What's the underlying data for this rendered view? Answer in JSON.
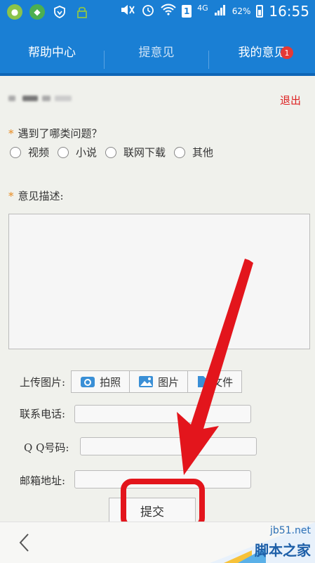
{
  "status_bar": {
    "time": "16:55",
    "battery": "62%",
    "network": "4G",
    "sim": "1"
  },
  "tabs": [
    {
      "label": "帮助中心"
    },
    {
      "label": "提意见"
    },
    {
      "label": "我的意见",
      "badge": "1"
    }
  ],
  "header": {
    "logout": "退出"
  },
  "form": {
    "question_label": "遇到了哪类问题？",
    "required_mark": "*",
    "options": [
      "视频",
      "小说",
      "联网下载",
      "其他"
    ],
    "description_label": "意见描述:",
    "upload_label": "上传图片:",
    "upload_buttons": [
      "拍照",
      "图片",
      "文件"
    ],
    "phone_label": "联系电话:",
    "qq_label": "Q Q号码:",
    "email_label": "邮箱地址:",
    "submit_label": "提交"
  },
  "watermark": {
    "site": "jb51.net",
    "name": "脚本之家"
  },
  "colors": {
    "primary": "#1a7fd4",
    "accent": "#e3151c",
    "logout": "#dd2222"
  }
}
